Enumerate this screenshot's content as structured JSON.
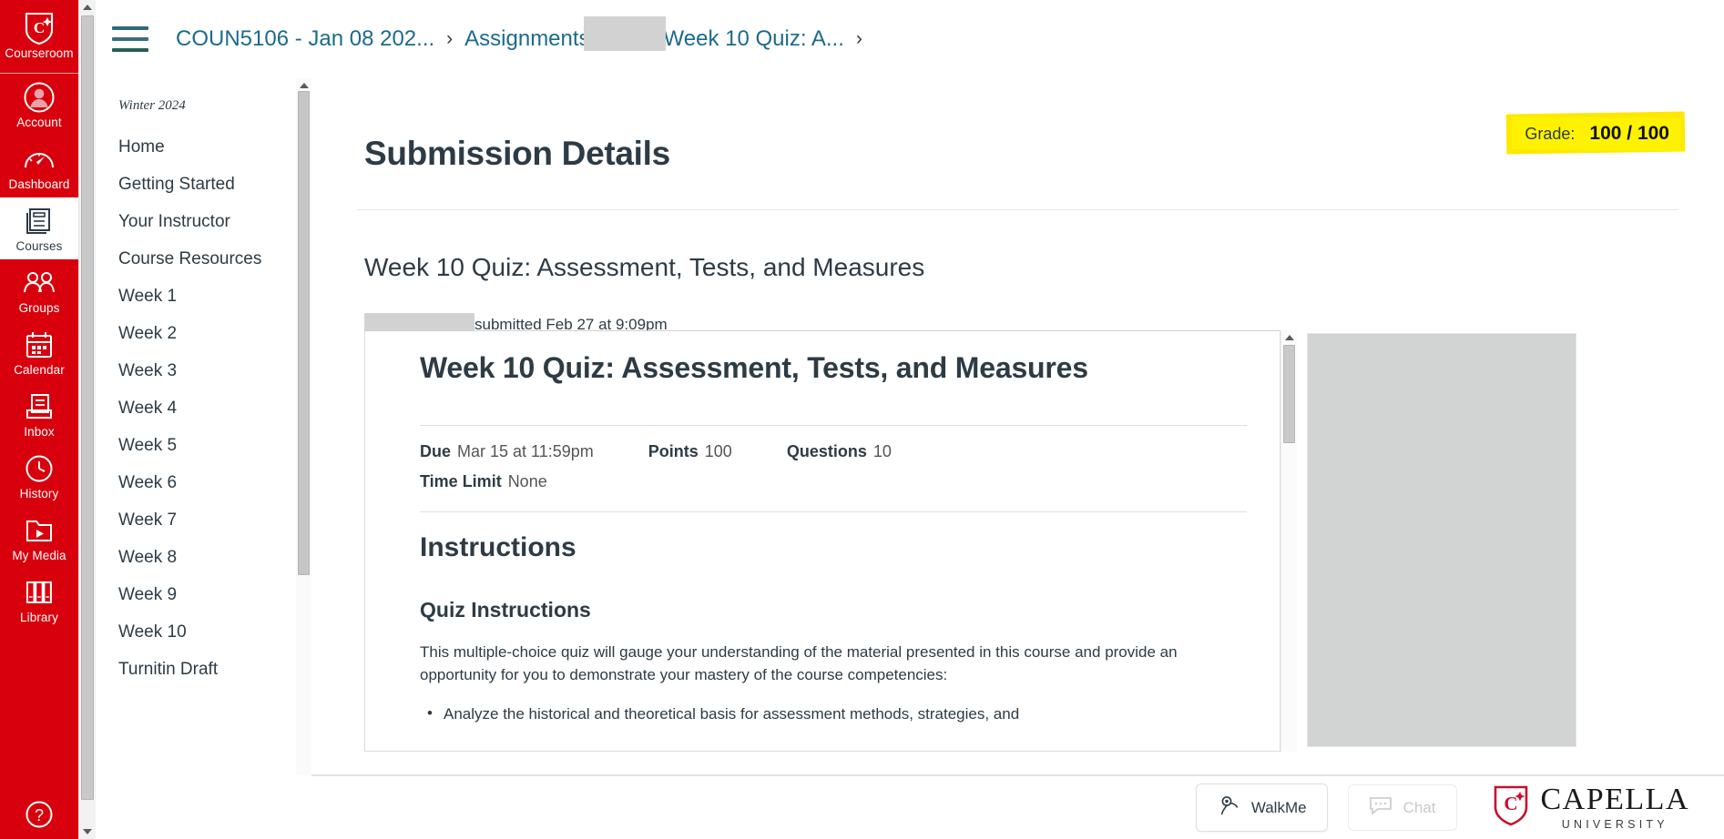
{
  "globalnav": {
    "items": [
      {
        "id": "courseroom",
        "label": "Courseroom",
        "icon": "capella-shield-icon",
        "active": false,
        "brand": true
      },
      {
        "id": "account",
        "label": "Account",
        "icon": "user-avatar-icon",
        "active": false
      },
      {
        "id": "dashboard",
        "label": "Dashboard",
        "icon": "speedometer-icon",
        "active": false
      },
      {
        "id": "courses",
        "label": "Courses",
        "icon": "book-icon",
        "active": true
      },
      {
        "id": "groups",
        "label": "Groups",
        "icon": "people-icon",
        "active": false
      },
      {
        "id": "calendar",
        "label": "Calendar",
        "icon": "calendar-icon",
        "active": false
      },
      {
        "id": "inbox",
        "label": "Inbox",
        "icon": "inbox-icon",
        "active": false
      },
      {
        "id": "history",
        "label": "History",
        "icon": "clock-icon",
        "active": false
      },
      {
        "id": "mymedia",
        "label": "My Media",
        "icon": "folder-play-icon",
        "active": false
      },
      {
        "id": "library",
        "label": "Library",
        "icon": "books-icon",
        "active": false
      }
    ],
    "help_icon": "question-mark-circle-icon"
  },
  "topbar": {
    "menu_icon": "hamburger-menu-icon",
    "breadcrumbs": [
      {
        "label": "COUN5106 - Jan 08 202...",
        "redacted": false
      },
      {
        "label": "Assignments",
        "redacted": false
      },
      {
        "label": "",
        "redacted": true
      },
      {
        "label": "Week 10 Quiz: A...",
        "redacted": false
      }
    ],
    "separator": "›"
  },
  "coursenav": {
    "term": "Winter 2024",
    "items": [
      {
        "label": "Home"
      },
      {
        "label": "Getting Started"
      },
      {
        "label": "Your Instructor"
      },
      {
        "label": "Course Resources"
      },
      {
        "label": "Week 1"
      },
      {
        "label": "Week 2"
      },
      {
        "label": "Week 3"
      },
      {
        "label": "Week 4"
      },
      {
        "label": "Week 5"
      },
      {
        "label": "Week 6"
      },
      {
        "label": "Week 7"
      },
      {
        "label": "Week 8"
      },
      {
        "label": "Week 9"
      },
      {
        "label": "Week 10"
      },
      {
        "label": "Turnitin Draft"
      }
    ]
  },
  "main": {
    "page_title": "Submission Details",
    "grade": {
      "label": "Grade:",
      "value": "100 / 100",
      "highlight_color": "#fff200"
    },
    "assignment_title": "Week 10 Quiz: Assessment, Tests, and Measures",
    "submitted_text": "submitted Feb 27 at 9:09pm",
    "submitter_redacted": true
  },
  "quiz": {
    "title": "Week 10 Quiz: Assessment, Tests, and Measures",
    "meta": [
      {
        "label": "Due",
        "value": "Mar 15 at 11:59pm"
      },
      {
        "label": "Points",
        "value": "100"
      },
      {
        "label": "Questions",
        "value": "10"
      },
      {
        "label": "Time Limit",
        "value": "None"
      }
    ],
    "instructions_heading": "Instructions",
    "quiz_instructions_heading": "Quiz Instructions",
    "intro_paragraph": "This multiple-choice quiz will gauge your understanding of the material presented in this course and provide an opportunity for you to demonstrate your mastery of the course competencies:",
    "bullets": [
      "Analyze the historical and theoretical basis for assessment methods, strategies, and"
    ]
  },
  "footer": {
    "walkme_label": "WalkMe",
    "walkme_icon": "walkme-pin-icon",
    "chat_label": "Chat",
    "chat_icon": "chat-bubble-icon",
    "brand_name": "CAPELLA",
    "brand_sub": "UNIVERSITY",
    "brand_icon": "capella-shield-icon"
  },
  "colors": {
    "brand_red": "#d8000c",
    "link_blue": "#1c6b8c",
    "text_dark": "#2d3b45",
    "highlight_yellow": "#fff200"
  }
}
